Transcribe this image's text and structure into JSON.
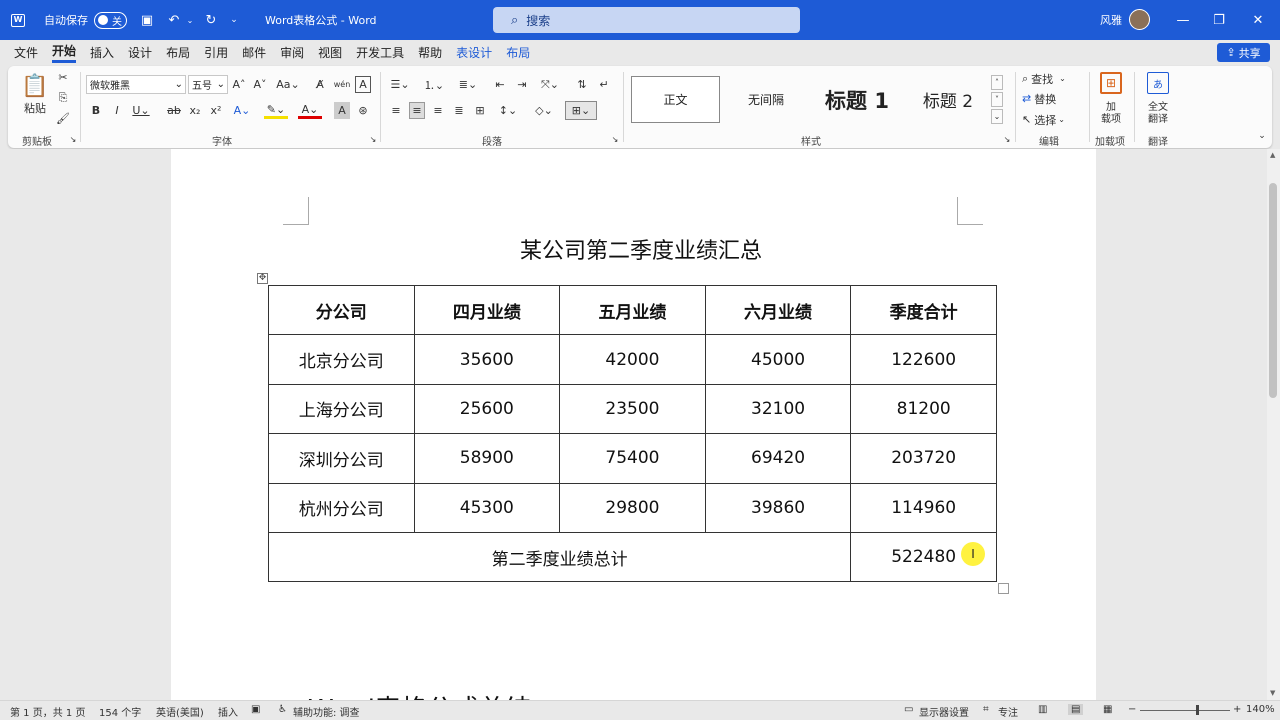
{
  "titlebar": {
    "app_icon": "word-icon",
    "autosave_label": "自动保存",
    "autosave_state": "关",
    "doc_title": "Word表格公式 - Word",
    "search_placeholder": "搜索",
    "user_name": "风雅"
  },
  "menu": {
    "items": [
      "文件",
      "开始",
      "插入",
      "设计",
      "布局",
      "引用",
      "邮件",
      "审阅",
      "视图",
      "开发工具",
      "帮助",
      "表设计",
      "布局"
    ],
    "active": "开始",
    "share_label": "共享"
  },
  "ribbon": {
    "clipboard": {
      "paste": "粘贴",
      "group": "剪贴板"
    },
    "font": {
      "family": "微软雅黑",
      "size": "五号",
      "group": "字体"
    },
    "paragraph": {
      "group": "段落"
    },
    "styles": {
      "items": [
        "正文",
        "无间隔",
        "标题 1",
        "标题 2"
      ],
      "group": "样式"
    },
    "editing": {
      "find": "查找",
      "replace": "替换",
      "select": "选择",
      "group": "编辑"
    },
    "addins": {
      "label_line1": "加",
      "label_line2": "载项",
      "group": "加载项"
    },
    "translate": {
      "label_line1": "全文",
      "label_line2": "翻译",
      "group": "翻译"
    }
  },
  "document": {
    "heading": "某公司第二季度业绩汇总",
    "table": {
      "headers": [
        "分公司",
        "四月业绩",
        "五月业绩",
        "六月业绩",
        "季度合计"
      ],
      "rows": [
        [
          "北京分公司",
          "35600",
          "42000",
          "45000",
          "122600"
        ],
        [
          "上海分公司",
          "25600",
          "23500",
          "32100",
          "81200"
        ],
        [
          "深圳分公司",
          "58900",
          "75400",
          "69420",
          "203720"
        ],
        [
          "杭州分公司",
          "45300",
          "29800",
          "39860",
          "114960"
        ]
      ],
      "total_label": "第二季度业绩总计",
      "total_value": "522480"
    },
    "next_heading": "Word表格公式总结"
  },
  "statusbar": {
    "page": "第 1 页，共 1 页",
    "words": "154 个字",
    "language": "英语(美国)",
    "insert_mode": "插入",
    "accessibility": "辅助功能: 调查",
    "display_settings": "显示器设置",
    "focus": "专注",
    "zoom": "140%"
  }
}
